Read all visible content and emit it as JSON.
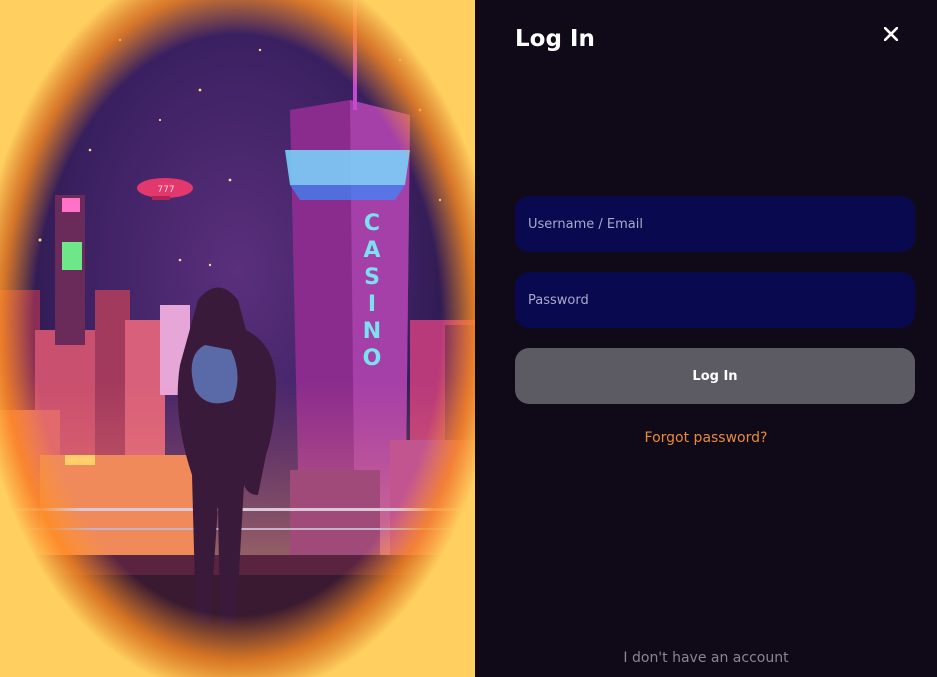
{
  "modal": {
    "title": "Log In",
    "close_icon": "close-icon",
    "username": {
      "placeholder": "Username / Email",
      "value": ""
    },
    "password": {
      "placeholder": "Password",
      "value": ""
    },
    "login_button_label": "Log In",
    "forgot_password_link": "Forgot password?",
    "no_account_link": "I don't have an account"
  },
  "illustration": {
    "sign_text": "CASINO",
    "blimp_text": "777"
  },
  "colors": {
    "panel_bg": "#100a18",
    "input_bg": "#08094f",
    "button_bg": "#5c5a62",
    "link_accent": "#e88a3c",
    "muted_text": "#8b8592"
  }
}
